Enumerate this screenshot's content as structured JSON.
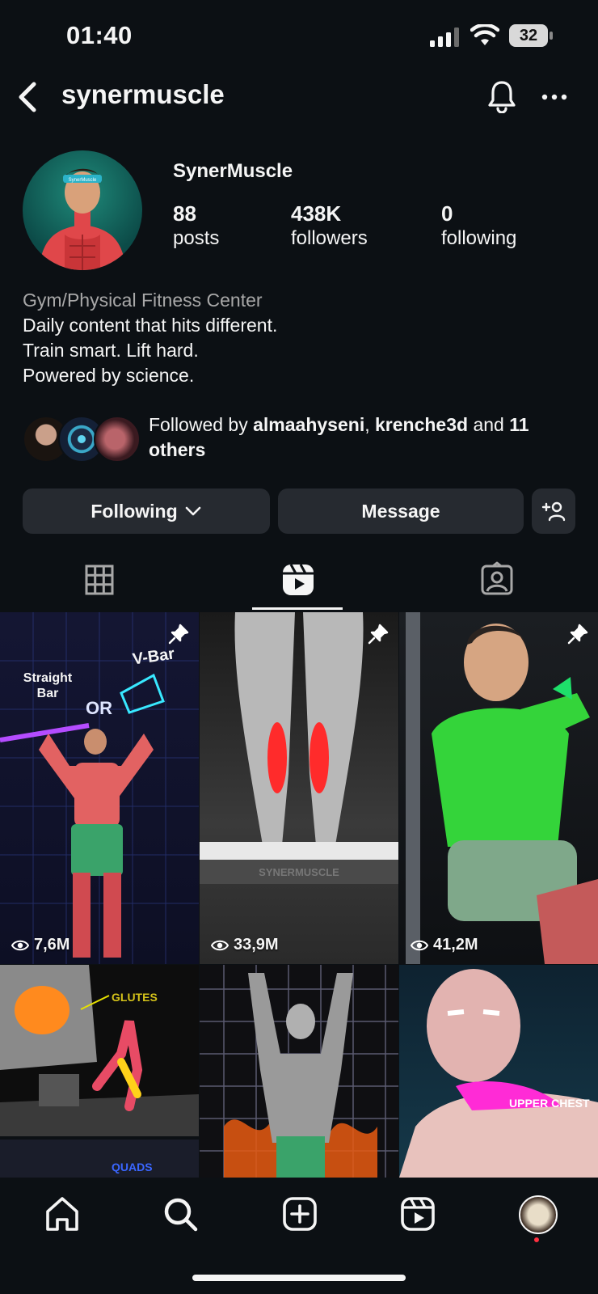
{
  "status_bar": {
    "time": "01:40",
    "battery": "32"
  },
  "header": {
    "username": "synermuscle"
  },
  "profile": {
    "display_name": "SynerMuscle",
    "stats": [
      {
        "value": "88",
        "label": "posts"
      },
      {
        "value": "438K",
        "label": "followers"
      },
      {
        "value": "0",
        "label": "following"
      }
    ],
    "category": "Gym/Physical Fitness Center",
    "bio_lines": [
      "Daily content that hits different.",
      "Train smart. Lift hard.",
      "Powered by science."
    ],
    "followed_by": {
      "prefix": "Followed by ",
      "user1": "almaahyseni",
      "sep": ", ",
      "user2": "krenche3d",
      "and": " and ",
      "others": "11 others"
    }
  },
  "buttons": {
    "following": "Following",
    "message": "Message"
  },
  "tabs": [
    "posts-grid",
    "reels",
    "tagged"
  ],
  "reels": [
    {
      "views": "7,6M",
      "pinned": true,
      "overlay": [
        "Straight Bar",
        "V-Bar",
        "OR"
      ]
    },
    {
      "views": "33,9M",
      "pinned": true,
      "overlay": [
        "SYNERMUSCLE"
      ]
    },
    {
      "views": "41,2M",
      "pinned": true,
      "overlay": []
    },
    {
      "views": "",
      "pinned": false,
      "overlay": [
        "GLUTES"
      ]
    },
    {
      "views": "",
      "pinned": false,
      "overlay": []
    },
    {
      "views": "",
      "pinned": false,
      "overlay": [
        "UPPER CHEST"
      ]
    },
    {
      "views": "",
      "pinned": false,
      "overlay": [
        "QUADS"
      ]
    }
  ],
  "colors": {
    "background": "#0c1014",
    "button": "#262a30",
    "muscle_red": "#e0474a",
    "muscle_green": "#2fbf3a",
    "notification_dot": "#ff3040"
  }
}
